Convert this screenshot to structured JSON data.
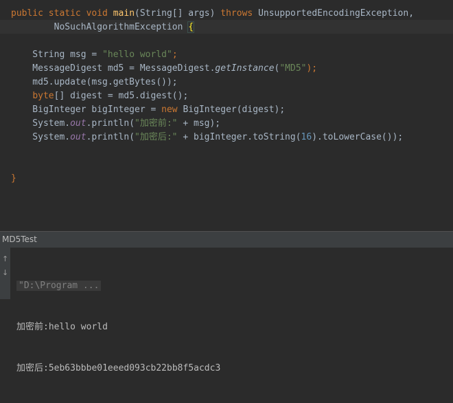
{
  "editor": {
    "lines": [
      {
        "tokens": [
          {
            "t": "public static void ",
            "c": "kw"
          },
          {
            "t": "main",
            "c": "fn"
          },
          {
            "t": "(String[] args) ",
            "c": ""
          },
          {
            "t": "throws ",
            "c": "kw"
          },
          {
            "t": "UnsupportedEncodingException,",
            "c": ""
          }
        ]
      },
      {
        "tokens": [
          {
            "t": "        NoSuchAlgorithmException ",
            "c": ""
          },
          {
            "t": "{",
            "c": "brace"
          }
        ]
      },
      {
        "tokens": []
      },
      {
        "tokens": [
          {
            "t": "    String msg = ",
            "c": ""
          },
          {
            "t": "\"hello world\"",
            "c": "str"
          },
          {
            "t": ";",
            "c": "kw"
          }
        ]
      },
      {
        "tokens": [
          {
            "t": "    MessageDigest md5 = MessageDigest.",
            "c": ""
          },
          {
            "t": "getInstance",
            "c": "ital"
          },
          {
            "t": "(",
            "c": ""
          },
          {
            "t": "\"MD5\"",
            "c": "str"
          },
          {
            "t": ");",
            "c": "kw"
          }
        ]
      },
      {
        "tokens": [
          {
            "t": "    md5.update(msg.getBytes());",
            "c": ""
          }
        ]
      },
      {
        "tokens": [
          {
            "t": "    ",
            "c": ""
          },
          {
            "t": "byte",
            "c": "kw"
          },
          {
            "t": "[] digest = md5.digest();",
            "c": ""
          }
        ]
      },
      {
        "tokens": [
          {
            "t": "    BigInteger bigInteger = ",
            "c": ""
          },
          {
            "t": "new ",
            "c": "kw"
          },
          {
            "t": "BigInteger(digest);",
            "c": ""
          }
        ]
      },
      {
        "tokens": [
          {
            "t": "    System.",
            "c": ""
          },
          {
            "t": "out",
            "c": "stat"
          },
          {
            "t": ".println(",
            "c": ""
          },
          {
            "t": "\"加密前:\"",
            "c": "str"
          },
          {
            "t": " + msg);",
            "c": ""
          }
        ]
      },
      {
        "tokens": [
          {
            "t": "    System.",
            "c": ""
          },
          {
            "t": "out",
            "c": "stat"
          },
          {
            "t": ".println(",
            "c": ""
          },
          {
            "t": "\"加密后:\"",
            "c": "str"
          },
          {
            "t": " + bigInteger.toString(",
            "c": ""
          },
          {
            "t": "16",
            "c": "num"
          },
          {
            "t": ").toLowerCase());",
            "c": ""
          }
        ]
      },
      {
        "tokens": []
      },
      {
        "tokens": []
      },
      {
        "tokens": [
          {
            "t": "}",
            "c": "kw"
          }
        ]
      }
    ]
  },
  "run": {
    "title": "MD5Test",
    "command": "\"D:\\Program ...",
    "output": [
      "加密前:hello world",
      "加密后:5eb63bbbe01eeed093cb22bb8f5acdc3"
    ],
    "gutter_icons": [
      "arrow-up-icon",
      "arrow-down-icon"
    ]
  }
}
